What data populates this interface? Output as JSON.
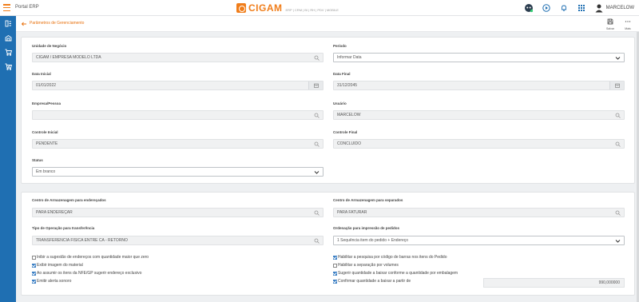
{
  "topbar": {
    "portal": "Portal ERP",
    "brand": "CIGAM",
    "brand_sub": "ERP | CRM | BI | RH | PDV | MOBILE",
    "user": "MARCELOW"
  },
  "header": {
    "title": "Parâmetros de Gerenciamento",
    "save": "Salvar",
    "more": "Mais"
  },
  "section1": {
    "unidade": {
      "label": "Unidade de Negócio",
      "value": "CIGAM / EMPRESA MODELO LTDA"
    },
    "periodo": {
      "label": "Período",
      "value": "Informar Data"
    },
    "data_inicial": {
      "label": "Data Inicial",
      "value": "01/01/2022"
    },
    "data_final": {
      "label": "Data Final",
      "value": "31/12/2045"
    },
    "empresa": {
      "label": "Empresa/Pessoa",
      "value": ""
    },
    "usuario": {
      "label": "Usuário",
      "value": "MARCELOW"
    },
    "controle_inicial": {
      "label": "Controle Inicial",
      "value": "PENDENTE"
    },
    "controle_final": {
      "label": "Controle Final",
      "value": "CONCLUIDO"
    },
    "status": {
      "label": "Status",
      "value": "Em branco"
    }
  },
  "section2": {
    "centro_enderecados": {
      "label": "Centro de Armazenagem para endereçados",
      "value": "PARA ENDEREÇAR"
    },
    "centro_separados": {
      "label": "Centro de Armazenagem para separados",
      "value": "PARA FATURAR"
    },
    "tipo_operacao": {
      "label": "Tipo de Operação para transferência",
      "value": "TRANSFERENCIA FISICA ENTRE CA - RETORNO"
    },
    "ordenacao": {
      "label": "Ordenação para impressão de pedidos",
      "value": "1 Sequência item do pedido + Endereço"
    },
    "checks_left": [
      {
        "label": "Inibir a sugestão de endereços com quantidade maior que zero",
        "checked": false
      },
      {
        "label": "Exibir imagem do material",
        "checked": true
      },
      {
        "label": "Ao assumir os itens da NFE/GP sugerir endereço exclusivo",
        "checked": true
      },
      {
        "label": "Emitir alerta sonoro",
        "checked": true
      }
    ],
    "checks_right": [
      {
        "label": "Habilitar a pesquisa por código de barras nos itens do Pedido",
        "checked": true
      },
      {
        "label": "Habilitar a separação por volumes",
        "checked": false
      },
      {
        "label": "Sugerir quantidade a baixar conforme a quantidade por embalagem",
        "checked": true
      },
      {
        "label": "Confirmar quantidade a baixar a partir de",
        "checked": true
      }
    ],
    "confirm_value": "990,000000"
  }
}
